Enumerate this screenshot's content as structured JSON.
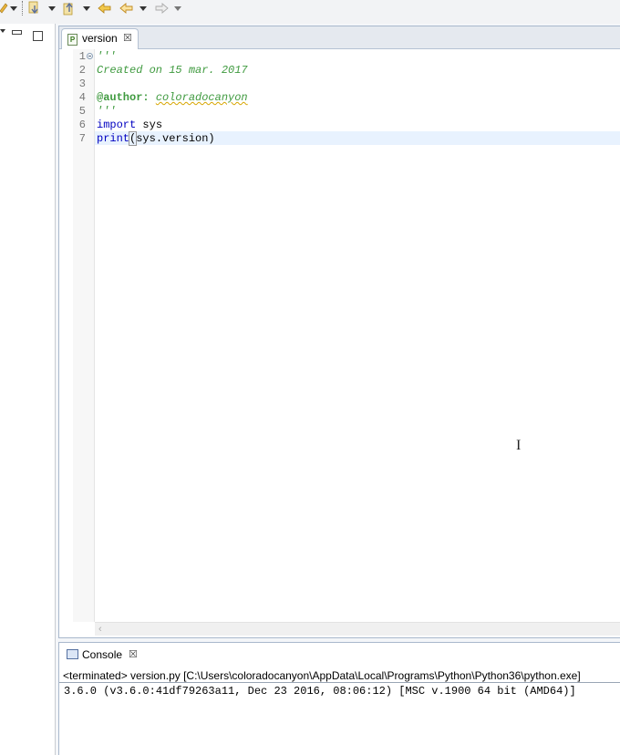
{
  "editor": {
    "tab_title": "version",
    "tab_close": "☒",
    "tab_icon_letter": "P",
    "line_numbers": [
      "1",
      "2",
      "3",
      "4",
      "5",
      "6",
      "7"
    ],
    "lines": {
      "l1": "'''",
      "l2": "Created on 15 mar. 2017",
      "l4_tag": "@author:",
      "l4_author": "coloradocanyon",
      "l5": "'''",
      "l6_kw": "import",
      "l6_rest": " sys",
      "l7_kw": "print",
      "l7_open": "(",
      "l7_rest": "sys.version)"
    },
    "scroll_left": "‹",
    "mouse_cursor": "I"
  },
  "console": {
    "tab_title": "Console",
    "tab_close": "☒",
    "status": "<terminated> version.py [C:\\Users\\coloradocanyon\\AppData\\Local\\Programs\\Python\\Python36\\python.exe]",
    "output": "3.6.0 (v3.6.0:41df79263a11, Dec 23 2016, 08:06:12) [MSC v.1900 64 bit (AMD64)]"
  },
  "toolbar": {
    "icons": [
      "pencil-icon",
      "next-annotation-icon",
      "previous-annotation-icon",
      "back-icon",
      "forward-icon"
    ]
  },
  "colors": {
    "docstring": "#3f9a3f",
    "keyword": "#0000c0",
    "current_line": "#e8f2fe",
    "frame_border": "#a9b8cc"
  }
}
